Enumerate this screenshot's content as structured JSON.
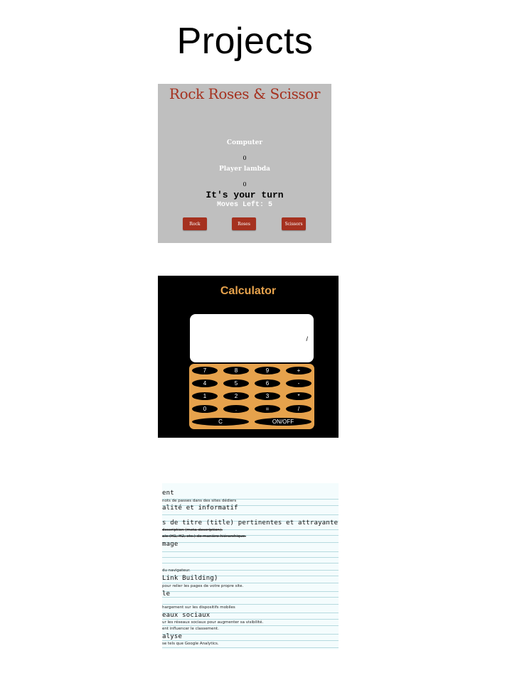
{
  "page": {
    "title": "Projects"
  },
  "rps": {
    "title": "Rock Roses & Scissor",
    "computer_label": "Computer",
    "computer_score": "0",
    "player_label": "Player lambda",
    "player_score": "0",
    "turn_text": "It's your turn",
    "moves_text": "Moves Left: 5",
    "buttons": [
      "Rock",
      "Roses",
      "Scissors"
    ],
    "colors": {
      "background": "#bfbfbf",
      "accent": "#a5311f"
    }
  },
  "calculator": {
    "title": "Calculator",
    "display": "/",
    "keys": [
      [
        "7",
        "8",
        "9",
        "+"
      ],
      [
        "4",
        "5",
        "6",
        "-"
      ],
      [
        "1",
        "2",
        "3",
        "*"
      ],
      [
        "0",
        ".",
        "=",
        "/"
      ]
    ],
    "bottom_keys": [
      "C",
      "ON/OFF"
    ],
    "colors": {
      "background": "#000000",
      "accent": "#e6a24c"
    }
  },
  "seo": {
    "lines": [
      "ent",
      "nots de passes dans des sites dédiers",
      "alité et informatif",
      "s de titre (title) pertinentes et attrayantes",
      "description (meta description).",
      "ale (H1, H2, etc.) de manière hiérarchique.",
      "mage",
      "du navigateur.",
      "Link Building)",
      "pour relier les pages de votre propre site.",
      "le",
      "hargement sur les dispositifs mobiles",
      "eaux sociaux",
      "ur les réseaux sociaux pour augmenter sa visibilité.",
      "ent influencer le classement.",
      "alyse",
      "se tels que Google Analytics."
    ]
  }
}
